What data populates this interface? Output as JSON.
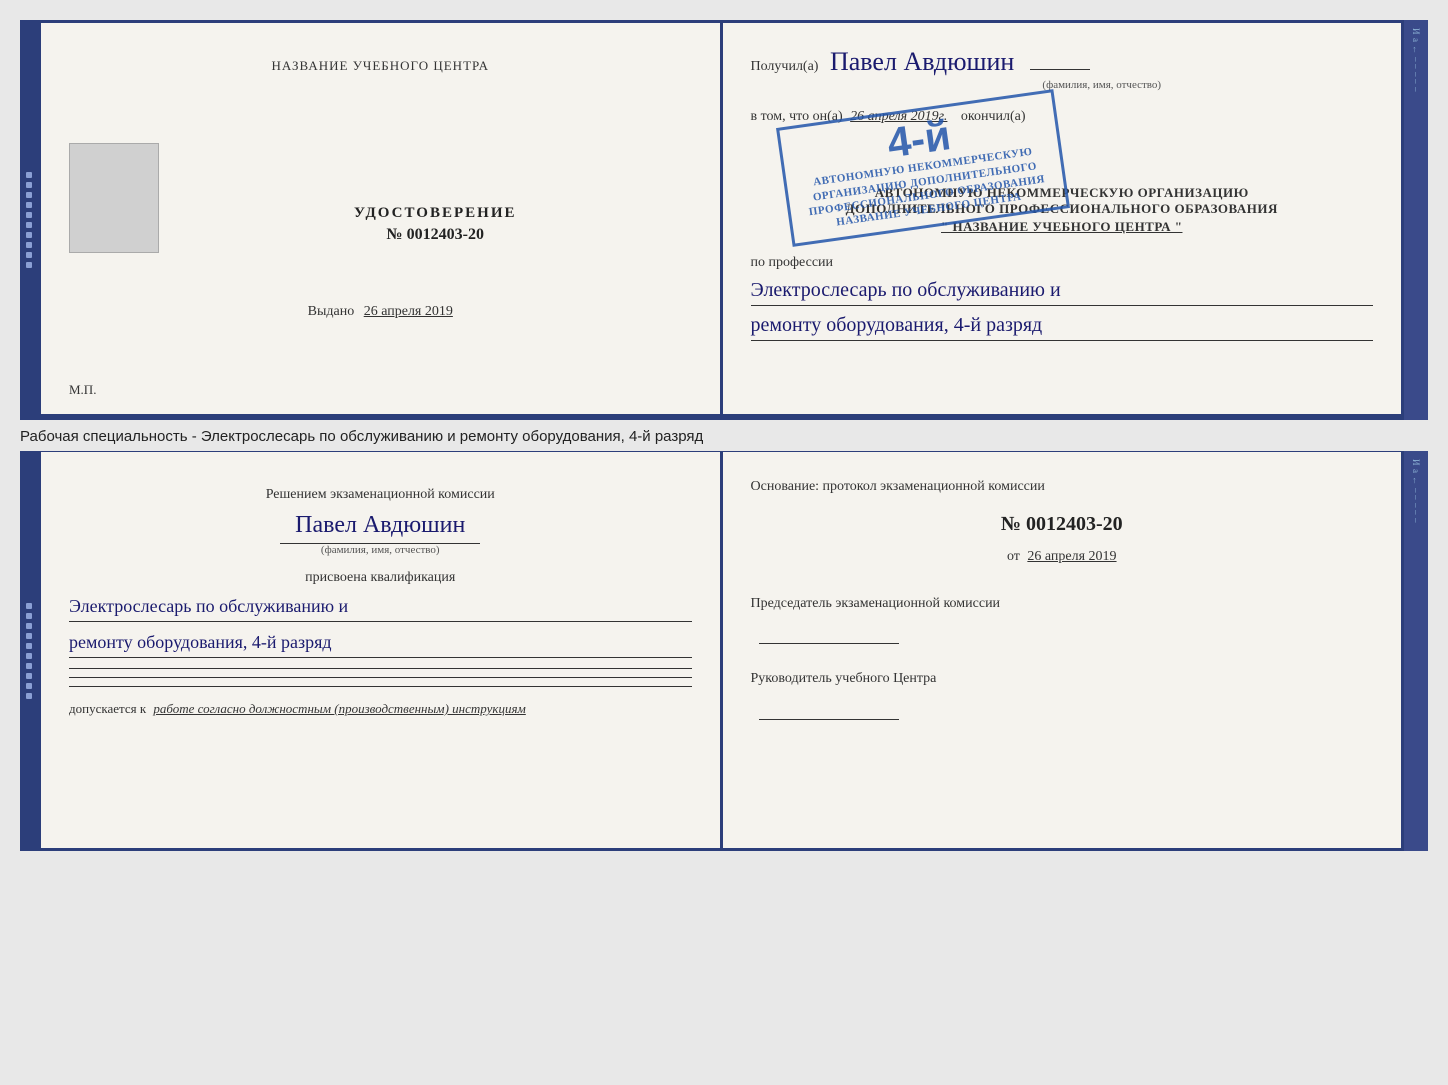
{
  "top_document": {
    "left": {
      "institution_label": "НАЗВАНИЕ УЧЕБНОГО ЦЕНТРА",
      "doc_title": "УДОСТОВЕРЕНИЕ",
      "doc_number": "№ 0012403-20",
      "issued_label": "Выдано",
      "issued_date": "26 апреля 2019",
      "mp_label": "М.П."
    },
    "right": {
      "received_prefix": "Получил(а)",
      "recipient_name": "Павел Авдюшин",
      "fio_label": "(фамилия, имя, отчество)",
      "vtom_prefix": "в том, что он(а)",
      "vtom_date": "26 апреля 2019г.",
      "finished_label": "окончил(а)",
      "org_line1": "АВТОНОМНУЮ НЕКОММЕРЧЕСКУЮ ОРГАНИЗАЦИЮ",
      "org_line2": "ДОПОЛНИТЕЛЬНОГО ПРОФЕССИОНАЛЬНОГО ОБРАЗОВАНИЯ",
      "org_name": "\"     НАЗВАНИЕ УЧЕБНОГО ЦЕНТРА     \"",
      "profession_label": "по профессии",
      "profession_line1": "Электрослесарь по обслуживанию и",
      "profession_line2": "ремонту оборудования, 4-й разряд",
      "stamp_number": "4-й",
      "stamp_line1": "АВТОНОМНУЮ НЕКОММЕРЧЕСКУЮ",
      "stamp_line2": "ОРГАНИЗАЦИЮ ДОПОЛНИТЕЛЬНОГО",
      "stamp_line3": "ПРОФЕССИОНАЛЬНОГО ОБРАЗОВАНИЯ",
      "stamp_line4": "НАЗВАНИЕ УЧЕБНОГО ЦЕНТРА"
    }
  },
  "between_text": "Рабочая специальность - Электрослесарь по обслуживанию и ремонту оборудования, 4-й разряд",
  "bottom_document": {
    "left": {
      "decision_text": "Решением экзаменационной комиссии",
      "person_name": "Павел Авдюшин",
      "fio_label": "(фамилия, имя, отчество)",
      "assigned_label": "присвоена квалификация",
      "qual_line1": "Электрослесарь по обслуживанию и",
      "qual_line2": "ремонту оборудования, 4-й разряд",
      "allowed_label": "допускается к",
      "allowed_text": "работе согласно должностным (производственным) инструкциям"
    },
    "right": {
      "basis_label": "Основание: протокол экзаменационной комиссии",
      "number_label": "№ 0012403-20",
      "date_prefix": "от",
      "date_value": "26 апреля 2019",
      "chairman_label": "Председатель экзаменационной комиссии",
      "director_label": "Руководитель учебного Центра"
    }
  },
  "spine_chars": [
    "И",
    "а",
    "←",
    "–",
    "–",
    "–",
    "–",
    "–"
  ]
}
